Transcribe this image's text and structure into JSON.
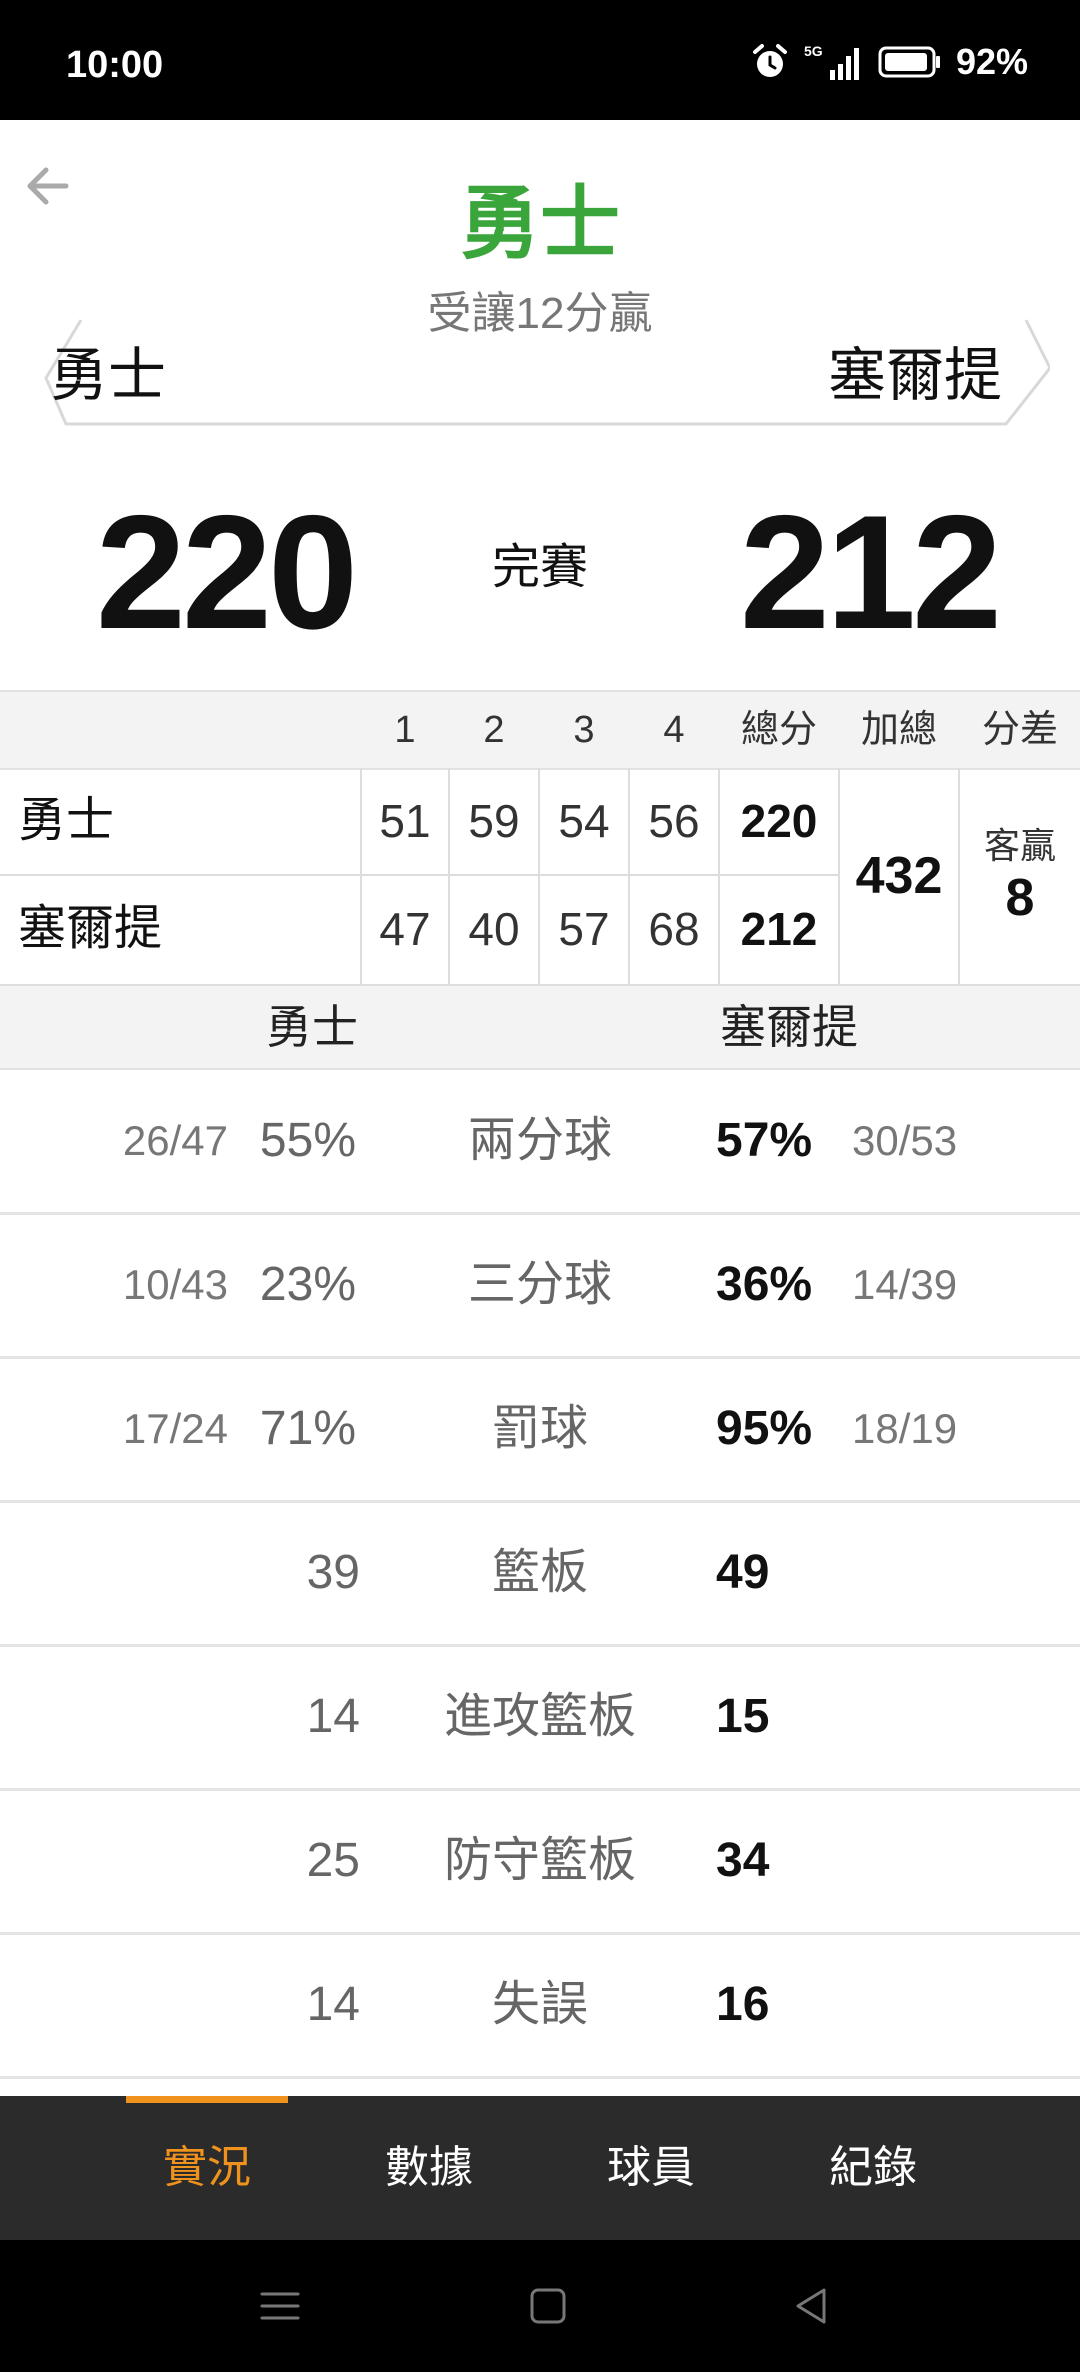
{
  "status_bar": {
    "time": "10:00",
    "network": "5G",
    "battery": "92%"
  },
  "header": {
    "favored_team": "勇士",
    "handicap_result": "受讓12分贏",
    "home_team": "勇士",
    "away_team": "塞爾提"
  },
  "score": {
    "home": "220",
    "status": "完賽",
    "away": "212"
  },
  "quarter_table": {
    "headers": [
      "1",
      "2",
      "3",
      "4",
      "總分",
      "加總",
      "分差"
    ],
    "rows": [
      {
        "team": "勇士",
        "q": [
          "51",
          "59",
          "54",
          "56"
        ],
        "total": "220"
      },
      {
        "team": "塞爾提",
        "q": [
          "47",
          "40",
          "57",
          "68"
        ],
        "total": "212"
      }
    ],
    "combined": "432",
    "diff_label": "客贏",
    "diff_value": "8"
  },
  "stats": {
    "home_team": "勇士",
    "away_team": "塞爾提",
    "rows": [
      {
        "label": "兩分球",
        "home_frac": "26/47",
        "home_pct": "55%",
        "away_pct": "57%",
        "away_frac": "30/53"
      },
      {
        "label": "三分球",
        "home_frac": "10/43",
        "home_pct": "23%",
        "away_pct": "36%",
        "away_frac": "14/39"
      },
      {
        "label": "罰球",
        "home_frac": "17/24",
        "home_pct": "71%",
        "away_pct": "95%",
        "away_frac": "18/19"
      },
      {
        "label": "籃板",
        "home": "39",
        "away": "49"
      },
      {
        "label": "進攻籃板",
        "home": "14",
        "away": "15"
      },
      {
        "label": "防守籃板",
        "home": "25",
        "away": "34"
      },
      {
        "label": "失誤",
        "home": "14",
        "away": "16"
      }
    ]
  },
  "tabs": [
    "實況",
    "數據",
    "球員",
    "紀錄"
  ],
  "colors": {
    "accent": "#f0921e",
    "favored": "#3aa53a",
    "tabbar": "#2b2b2b"
  }
}
